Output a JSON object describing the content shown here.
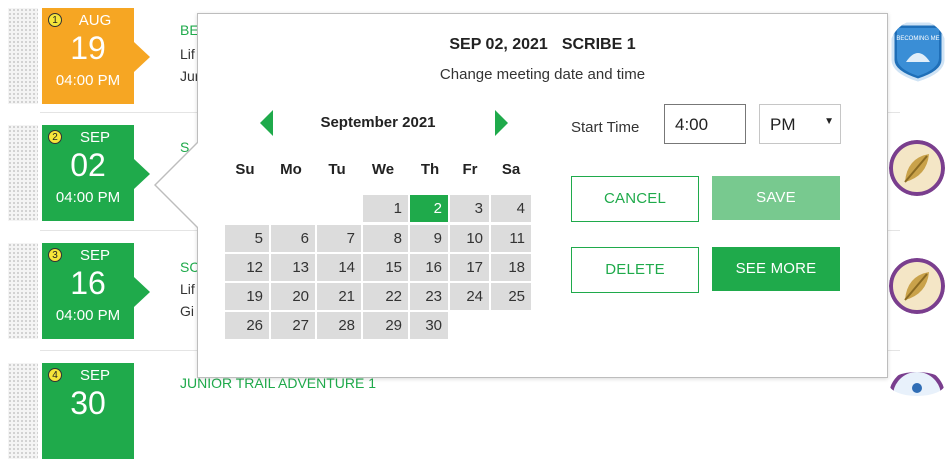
{
  "rows": [
    {
      "badge": "1",
      "month": "AUG",
      "day": "19",
      "time": "04:00 PM",
      "title": "BE",
      "sub1": "Lif",
      "sub2": "Jur"
    },
    {
      "badge": "2",
      "month": "SEP",
      "day": "02",
      "time": "04:00 PM",
      "title": "S",
      "sub1": "",
      "sub2": ""
    },
    {
      "badge": "3",
      "month": "SEP",
      "day": "16",
      "time": "04:00 PM",
      "title": "SC",
      "sub1": "Lif",
      "sub2": "Gi"
    },
    {
      "badge": "4",
      "month": "SEP",
      "day": "30",
      "time": "",
      "title": "JUNIOR TRAIL ADVENTURE 1",
      "sub1": "",
      "sub2": ""
    }
  ],
  "badges": [
    {
      "icon": "becoming-me-badge-icon",
      "label": "BECOMING ME"
    },
    {
      "icon": "leaf-badge-icon",
      "label": ""
    },
    {
      "icon": "leaf-badge-icon",
      "label": ""
    },
    {
      "icon": "trail-badge-icon",
      "label": ""
    }
  ],
  "modal": {
    "date": "SEP 02, 2021",
    "role": "SCRIBE 1",
    "subtitle": "Change meeting date and time",
    "calendar": {
      "month_label": "September 2021",
      "days_of_week": [
        "Su",
        "Mo",
        "Tu",
        "We",
        "Th",
        "Fr",
        "Sa"
      ],
      "weeks": [
        [
          "",
          "",
          "",
          "1",
          "2",
          "3",
          "4"
        ],
        [
          "5",
          "6",
          "7",
          "8",
          "9",
          "10",
          "11"
        ],
        [
          "12",
          "13",
          "14",
          "15",
          "16",
          "17",
          "18"
        ],
        [
          "19",
          "20",
          "21",
          "22",
          "23",
          "24",
          "25"
        ],
        [
          "26",
          "27",
          "28",
          "29",
          "30",
          "",
          ""
        ]
      ],
      "selected_day": "2"
    },
    "start_time_label": "Start Time",
    "start_time_value": "4:00",
    "ampm_value": "PM",
    "cancel_label": "CANCEL",
    "save_label": "SAVE",
    "delete_label": "DELETE",
    "see_more_label": "SEE MORE"
  },
  "colors": {
    "green": "#1faa4b",
    "orange": "#f6a623",
    "selected": "#1faa4b"
  }
}
